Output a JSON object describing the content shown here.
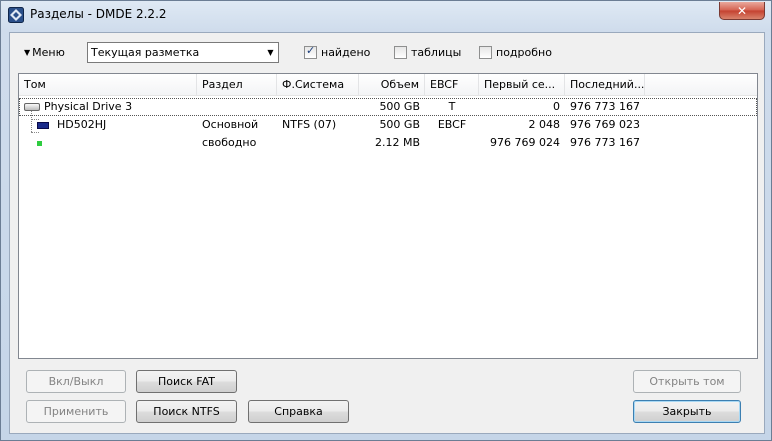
{
  "window": {
    "title": "Разделы - DMDE 2.2.2",
    "close_glyph": "✕"
  },
  "toolbar": {
    "menu_label": "Меню",
    "layout_combo_value": "Текущая разметка",
    "checks": [
      {
        "label": "найдено",
        "checked": true
      },
      {
        "label": "таблицы",
        "checked": false
      },
      {
        "label": "подробно",
        "checked": false
      }
    ]
  },
  "table": {
    "columns": [
      "Том",
      "Раздел",
      "Ф.Система",
      "Объем",
      "EBCF",
      "Первый се...",
      "Последний..."
    ],
    "rows": [
      {
        "tom": "Physical Drive 3",
        "razdel": "",
        "fs": "",
        "size": "500 GB",
        "ebcf": "T",
        "first": "0",
        "last": "976 773 167"
      },
      {
        "tom": "HD502HJ",
        "razdel": "Основной",
        "fs": "NTFS (07)",
        "size": "500 GB",
        "ebcf": "EBCF",
        "first": "2 048",
        "last": "976 769 023"
      },
      {
        "tom": "",
        "razdel": "свободно",
        "fs": "",
        "size": "2.12 MB",
        "ebcf": "",
        "first": "976 769 024",
        "last": "976 773 167"
      }
    ]
  },
  "buttons": {
    "toggle": "Вкл/Выкл",
    "apply": "Применить",
    "search_fat": "Поиск FAT",
    "search_ntfs": "Поиск NTFS",
    "help": "Справка",
    "open_volume": "Открыть том",
    "close": "Закрыть"
  }
}
